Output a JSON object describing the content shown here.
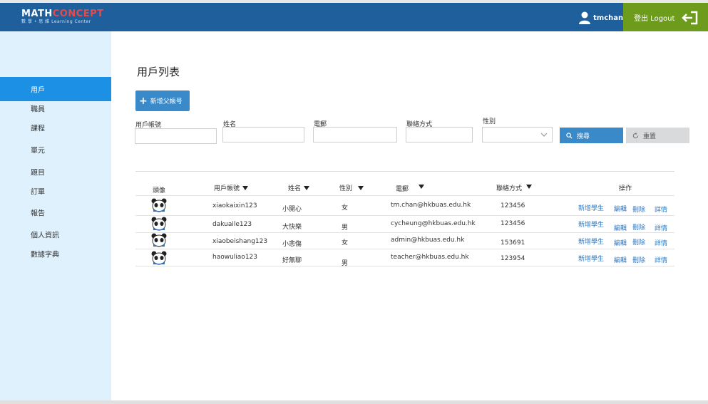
{
  "brand": {
    "logo_main_1": "MATH",
    "logo_main_2": "CONCEPT",
    "logo_sub": "數 學 • 思 維 Learning Center"
  },
  "header": {
    "username": "tmchan",
    "logout_label": "登出 Logout"
  },
  "sidebar": {
    "items": [
      {
        "label": "用戶",
        "active": true
      },
      {
        "label": "職員"
      },
      {
        "label": "課程"
      },
      {
        "label": "單元"
      },
      {
        "label": "題目"
      },
      {
        "label": "訂單"
      },
      {
        "label": "報告"
      },
      {
        "label": "個人資訊"
      },
      {
        "label": "數據字典"
      }
    ]
  },
  "main": {
    "title": "用戶列表",
    "add_button": "新增父帳号"
  },
  "filters": {
    "account_label": "用戶帳號",
    "name_label": "姓名",
    "email_label": "電郵",
    "contact_label": "聯絡方式",
    "gender_label": "性別",
    "account_value": "",
    "name_value": "",
    "email_value": "",
    "contact_value": "",
    "gender_value": "",
    "search_button": "搜尋",
    "reset_button": "重置"
  },
  "table": {
    "headers": {
      "avatar": "頭像",
      "account": "用戶帳號",
      "name": "姓名",
      "gender": "性別",
      "email": "電郵",
      "contact": "聯絡方式",
      "actions": "操作"
    },
    "rows": [
      {
        "account": "xiaokaixin123",
        "name": "小開心",
        "gender": "女",
        "email": "tm.chan@hkbuas.edu.hk",
        "contact": "123456"
      },
      {
        "account": "dakuaile123",
        "name": "大快樂",
        "gender": "男",
        "email": "cycheung@hkbuas.edu.hk",
        "contact": "123456"
      },
      {
        "account": "xiaobeishang123",
        "name": "小悲傷",
        "gender": "女",
        "email": "admin@hkbuas.edu.hk",
        "contact": "153691"
      },
      {
        "account": "haowuliao123",
        "name": "好無聊",
        "gender": "男",
        "email": "teacher@hkbuas.edu.hk",
        "contact": "123954"
      }
    ],
    "row_actions": {
      "add_student": "新增學生",
      "edit": "編輯",
      "delete": "刪除",
      "details": "詳情"
    }
  },
  "colors": {
    "header_bg": "#1f5f9b",
    "logout_bg": "#6d9c1c",
    "sidebar_bg": "#dff1fc",
    "active_bg": "#1c90e4",
    "primary": "#3a89c9",
    "link": "#2e78c2"
  }
}
